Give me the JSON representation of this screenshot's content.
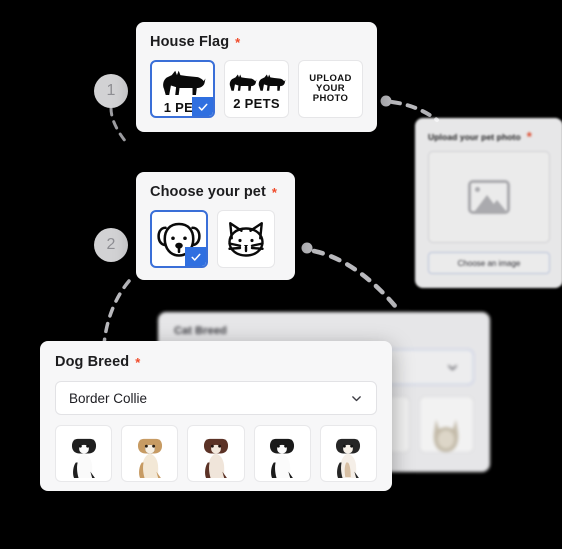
{
  "steps": [
    {
      "number": "1"
    },
    {
      "number": "2"
    }
  ],
  "house_flag": {
    "title": "House Flag",
    "required_marker": "*",
    "options": [
      {
        "label": "1 PET",
        "icon": "one-dog-silhouette-icon",
        "selected": true
      },
      {
        "label": "2 PETS",
        "icon": "two-dogs-silhouette-icon",
        "selected": false
      },
      {
        "label": "UPLOAD YOUR PHOTO",
        "icon": "text-only",
        "selected": false
      }
    ]
  },
  "choose_pet": {
    "title": "Choose your pet",
    "required_marker": "*",
    "options": [
      {
        "label": "Dog",
        "icon": "dog-face-outline-icon",
        "selected": true
      },
      {
        "label": "Cat",
        "icon": "cat-face-outline-icon",
        "selected": false
      }
    ]
  },
  "upload_photo": {
    "title": "Upload your pet photo",
    "required_marker": "*",
    "placeholder_icon": "image-placeholder-icon",
    "button_label": "Choose an image"
  },
  "cat_breed": {
    "title": "Cat Breed",
    "select_value": "",
    "thumbnails": [
      {
        "name": "cat-thumb-1"
      },
      {
        "name": "cat-thumb-2"
      }
    ]
  },
  "dog_breed": {
    "title": "Dog Breed",
    "required_marker": "*",
    "select_value": "Border Collie",
    "thumbnails": [
      {
        "name": "border-collie-black-white",
        "coat": "#2b2b2b",
        "chest": "#ffffff"
      },
      {
        "name": "border-collie-tan-white",
        "coat": "#c79b63",
        "chest": "#f3e6d2"
      },
      {
        "name": "border-collie-brown-white",
        "coat": "#5b3226",
        "chest": "#f0e5dc"
      },
      {
        "name": "border-collie-black-white-2",
        "coat": "#1f1f1f",
        "chest": "#fbfbfb"
      },
      {
        "name": "border-collie-tricolor",
        "coat": "#262626",
        "chest": "#f5efe8"
      }
    ]
  },
  "colors": {
    "accent_blue": "#2f6fe0",
    "select_border_blue": "#3a6fd8",
    "required_red": "#f04a2a",
    "badge_gray": "#d2d2d4",
    "connector_gray": "#b9b9bd",
    "card_bg": "#f6f6f7",
    "background": "#000000"
  }
}
